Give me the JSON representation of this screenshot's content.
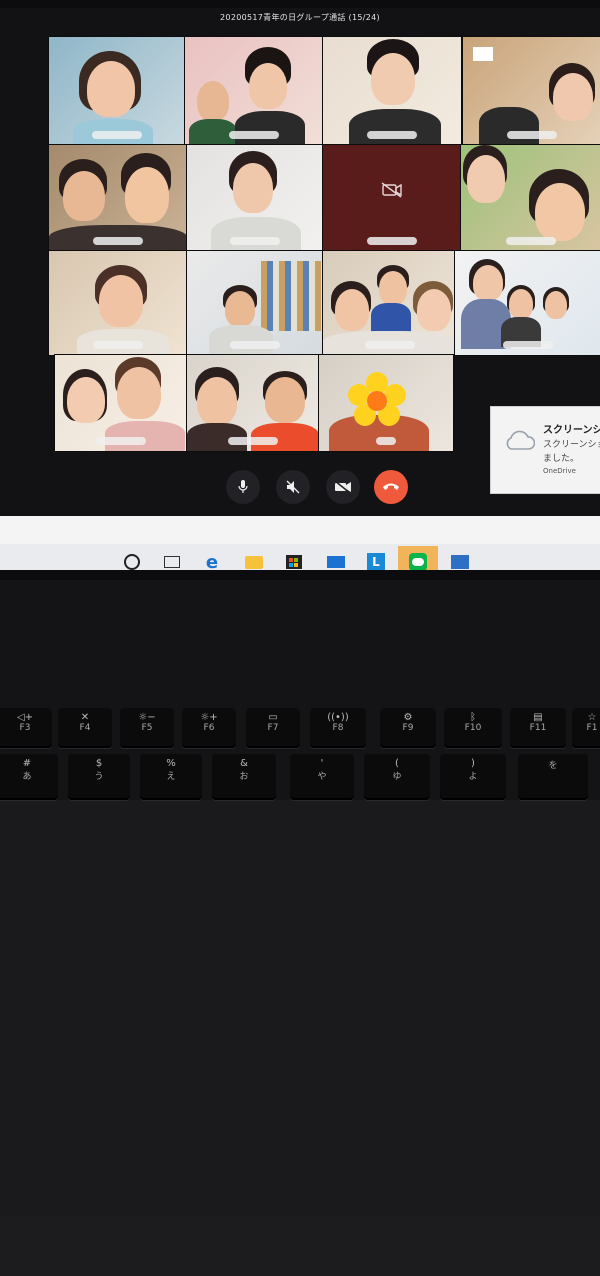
{
  "window": {
    "title": "20200517青年の日グループ通話 (15/24)"
  },
  "call_controls": [
    {
      "name": "mic-button",
      "icon": "microphone-icon"
    },
    {
      "name": "speaker-button",
      "icon": "speaker-muted-icon"
    },
    {
      "name": "camera-button",
      "icon": "camera-off-icon"
    },
    {
      "name": "end-call-button",
      "icon": "phone-hangup-icon"
    }
  ],
  "toast": {
    "title": "スクリーンショ",
    "line1": "スクリーンショ",
    "line2": "ました。",
    "app": "OneDrive"
  },
  "taskbar": {
    "items": [
      "search-circle-icon",
      "task-view-icon",
      "edge-icon",
      "file-explorer-icon",
      "store-icon",
      "mail-icon",
      "l-app-icon",
      "line-app-icon",
      "photos-icon"
    ]
  },
  "function_keys": [
    {
      "sym": "◁+",
      "label": "F3"
    },
    {
      "sym": "✕",
      "label": "F4"
    },
    {
      "sym": "☼−",
      "label": "F5"
    },
    {
      "sym": "☼+",
      "label": "F6"
    },
    {
      "sym": "▭",
      "label": "F7"
    },
    {
      "sym": "((•))",
      "label": "F8"
    },
    {
      "sym": "⚙",
      "label": "F9"
    },
    {
      "sym": "ᛒ",
      "label": "F10"
    },
    {
      "sym": "▤",
      "label": "F11"
    },
    {
      "sym": "☆",
      "label": "F1"
    }
  ],
  "number_keys": [
    {
      "main": "#",
      "kana": "あ"
    },
    {
      "main": "$",
      "kana": "う"
    },
    {
      "main": "%",
      "kana": "え"
    },
    {
      "main": "&",
      "kana": "お"
    },
    {
      "main": "'",
      "kana": "や"
    },
    {
      "main": "(",
      "kana": "ゆ"
    },
    {
      "main": ")",
      "kana": "よ"
    },
    {
      "main": "",
      "kana": "を"
    }
  ]
}
